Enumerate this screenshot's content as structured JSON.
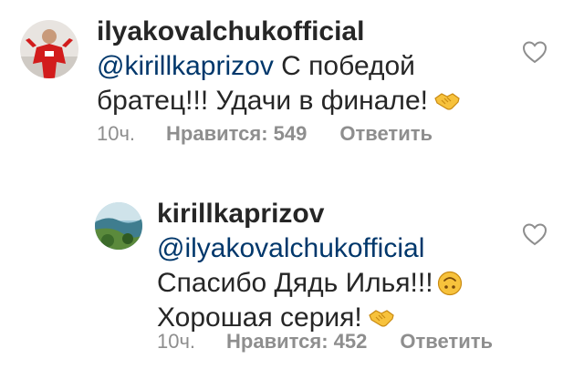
{
  "comments": [
    {
      "username": "ilyakovalchukofficial",
      "mention": "@kirillkaprizov",
      "text_line1": " С победой",
      "text_line2": "братец!!! Удачи в финале!",
      "time": "10ч.",
      "likes": "Нравится: 549",
      "reply": "Ответить",
      "avatar_icon": "profile-photo-red-jersey",
      "like_icon": "heart-outline-icon"
    },
    {
      "username": "kirillkaprizov",
      "mention": "@ilyakovalchukofficial",
      "text_line1": "Спасибо Дядь Илья!!!",
      "text_line2": "Хорошая серия!",
      "time": "10ч.",
      "likes": "Нравится: 452",
      "reply": "Ответить",
      "avatar_icon": "profile-photo-coast",
      "like_icon": "heart-outline-icon"
    }
  ],
  "colors": {
    "text": "#262626",
    "mention": "#00376b",
    "meta": "#8e8e8e",
    "emoji": "#f7c23c"
  }
}
